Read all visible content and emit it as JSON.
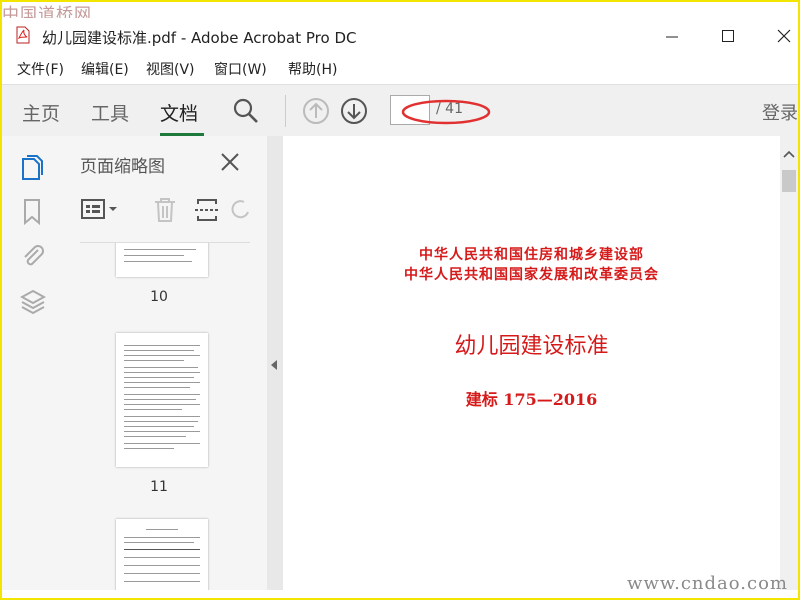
{
  "watermark": {
    "top": "中国道桥网",
    "bottom": "www.cndao.com"
  },
  "window": {
    "title": "幼儿园建设标准.pdf - Adobe Acrobat Pro DC"
  },
  "menu": [
    "文件(F)",
    "编辑(E)",
    "视图(V)",
    "窗口(W)",
    "帮助(H)"
  ],
  "toolbar": {
    "tabs": [
      {
        "label": "主页",
        "active": false
      },
      {
        "label": "工具",
        "active": false
      },
      {
        "label": "文档",
        "active": true
      }
    ],
    "page_current": "",
    "page_total": "/ 41",
    "login_label": "登录"
  },
  "panel": {
    "title": "页面缩略图",
    "thumbnails": [
      {
        "page": "10"
      },
      {
        "page": "11"
      }
    ]
  },
  "document": {
    "line1": "中华人民共和国住房和城乡建设部",
    "line2": "中华人民共和国国家发展和改革委员会",
    "title": "幼儿园建设标准",
    "code": "建标 175—2016"
  },
  "colors": {
    "accent": "#1e7a3c",
    "doc_red": "#d61a1a",
    "highlight": "#e03030"
  }
}
